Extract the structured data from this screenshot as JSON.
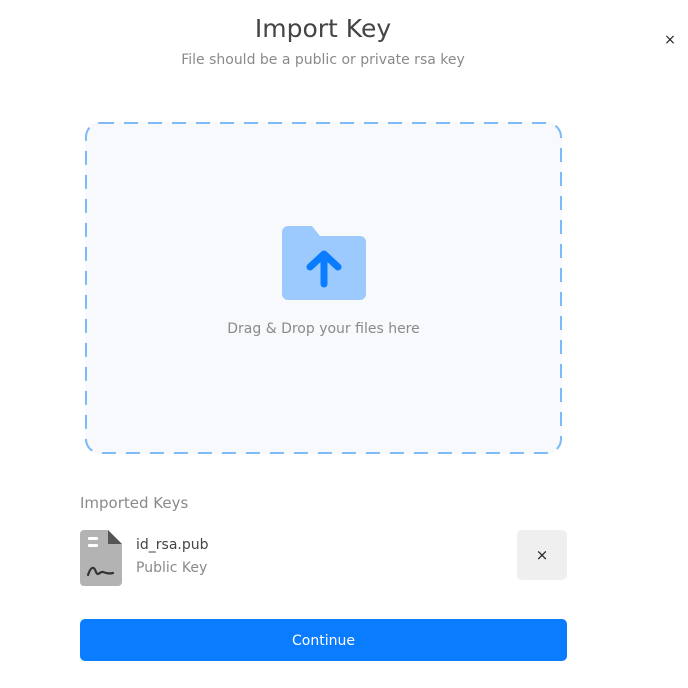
{
  "dialog": {
    "title": "Import Key",
    "subtitle": "File should be a public or private rsa key",
    "close_icon": "×"
  },
  "dropzone": {
    "text": "Drag & Drop your files here",
    "icon": "folder-upload-icon",
    "border_color": "#7dbaf7",
    "background": "#f8f9fd"
  },
  "imported": {
    "label": "Imported Keys",
    "items": [
      {
        "name": "id_rsa.pub",
        "type": "Public Key",
        "icon": "key-file-icon",
        "remove_icon": "×"
      }
    ]
  },
  "actions": {
    "continue_label": "Continue"
  },
  "colors": {
    "accent": "#0a7cff",
    "folder": "#9ccaff",
    "folder_arrow": "#0a7cff"
  }
}
